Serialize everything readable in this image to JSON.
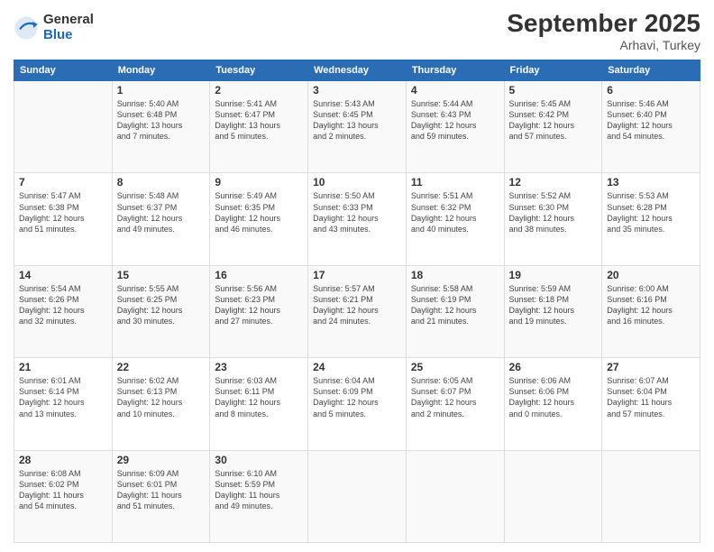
{
  "header": {
    "logo": {
      "general": "General",
      "blue": "Blue"
    },
    "month": "September 2025",
    "location": "Arhavi, Turkey"
  },
  "days_of_week": [
    "Sunday",
    "Monday",
    "Tuesday",
    "Wednesday",
    "Thursday",
    "Friday",
    "Saturday"
  ],
  "weeks": [
    [
      {
        "day": "",
        "info": ""
      },
      {
        "day": "1",
        "info": "Sunrise: 5:40 AM\nSunset: 6:48 PM\nDaylight: 13 hours\nand 7 minutes."
      },
      {
        "day": "2",
        "info": "Sunrise: 5:41 AM\nSunset: 6:47 PM\nDaylight: 13 hours\nand 5 minutes."
      },
      {
        "day": "3",
        "info": "Sunrise: 5:43 AM\nSunset: 6:45 PM\nDaylight: 13 hours\nand 2 minutes."
      },
      {
        "day": "4",
        "info": "Sunrise: 5:44 AM\nSunset: 6:43 PM\nDaylight: 12 hours\nand 59 minutes."
      },
      {
        "day": "5",
        "info": "Sunrise: 5:45 AM\nSunset: 6:42 PM\nDaylight: 12 hours\nand 57 minutes."
      },
      {
        "day": "6",
        "info": "Sunrise: 5:46 AM\nSunset: 6:40 PM\nDaylight: 12 hours\nand 54 minutes."
      }
    ],
    [
      {
        "day": "7",
        "info": "Sunrise: 5:47 AM\nSunset: 6:38 PM\nDaylight: 12 hours\nand 51 minutes."
      },
      {
        "day": "8",
        "info": "Sunrise: 5:48 AM\nSunset: 6:37 PM\nDaylight: 12 hours\nand 49 minutes."
      },
      {
        "day": "9",
        "info": "Sunrise: 5:49 AM\nSunset: 6:35 PM\nDaylight: 12 hours\nand 46 minutes."
      },
      {
        "day": "10",
        "info": "Sunrise: 5:50 AM\nSunset: 6:33 PM\nDaylight: 12 hours\nand 43 minutes."
      },
      {
        "day": "11",
        "info": "Sunrise: 5:51 AM\nSunset: 6:32 PM\nDaylight: 12 hours\nand 40 minutes."
      },
      {
        "day": "12",
        "info": "Sunrise: 5:52 AM\nSunset: 6:30 PM\nDaylight: 12 hours\nand 38 minutes."
      },
      {
        "day": "13",
        "info": "Sunrise: 5:53 AM\nSunset: 6:28 PM\nDaylight: 12 hours\nand 35 minutes."
      }
    ],
    [
      {
        "day": "14",
        "info": "Sunrise: 5:54 AM\nSunset: 6:26 PM\nDaylight: 12 hours\nand 32 minutes."
      },
      {
        "day": "15",
        "info": "Sunrise: 5:55 AM\nSunset: 6:25 PM\nDaylight: 12 hours\nand 30 minutes."
      },
      {
        "day": "16",
        "info": "Sunrise: 5:56 AM\nSunset: 6:23 PM\nDaylight: 12 hours\nand 27 minutes."
      },
      {
        "day": "17",
        "info": "Sunrise: 5:57 AM\nSunset: 6:21 PM\nDaylight: 12 hours\nand 24 minutes."
      },
      {
        "day": "18",
        "info": "Sunrise: 5:58 AM\nSunset: 6:19 PM\nDaylight: 12 hours\nand 21 minutes."
      },
      {
        "day": "19",
        "info": "Sunrise: 5:59 AM\nSunset: 6:18 PM\nDaylight: 12 hours\nand 19 minutes."
      },
      {
        "day": "20",
        "info": "Sunrise: 6:00 AM\nSunset: 6:16 PM\nDaylight: 12 hours\nand 16 minutes."
      }
    ],
    [
      {
        "day": "21",
        "info": "Sunrise: 6:01 AM\nSunset: 6:14 PM\nDaylight: 12 hours\nand 13 minutes."
      },
      {
        "day": "22",
        "info": "Sunrise: 6:02 AM\nSunset: 6:13 PM\nDaylight: 12 hours\nand 10 minutes."
      },
      {
        "day": "23",
        "info": "Sunrise: 6:03 AM\nSunset: 6:11 PM\nDaylight: 12 hours\nand 8 minutes."
      },
      {
        "day": "24",
        "info": "Sunrise: 6:04 AM\nSunset: 6:09 PM\nDaylight: 12 hours\nand 5 minutes."
      },
      {
        "day": "25",
        "info": "Sunrise: 6:05 AM\nSunset: 6:07 PM\nDaylight: 12 hours\nand 2 minutes."
      },
      {
        "day": "26",
        "info": "Sunrise: 6:06 AM\nSunset: 6:06 PM\nDaylight: 12 hours\nand 0 minutes."
      },
      {
        "day": "27",
        "info": "Sunrise: 6:07 AM\nSunset: 6:04 PM\nDaylight: 11 hours\nand 57 minutes."
      }
    ],
    [
      {
        "day": "28",
        "info": "Sunrise: 6:08 AM\nSunset: 6:02 PM\nDaylight: 11 hours\nand 54 minutes."
      },
      {
        "day": "29",
        "info": "Sunrise: 6:09 AM\nSunset: 6:01 PM\nDaylight: 11 hours\nand 51 minutes."
      },
      {
        "day": "30",
        "info": "Sunrise: 6:10 AM\nSunset: 5:59 PM\nDaylight: 11 hours\nand 49 minutes."
      },
      {
        "day": "",
        "info": ""
      },
      {
        "day": "",
        "info": ""
      },
      {
        "day": "",
        "info": ""
      },
      {
        "day": "",
        "info": ""
      }
    ]
  ]
}
